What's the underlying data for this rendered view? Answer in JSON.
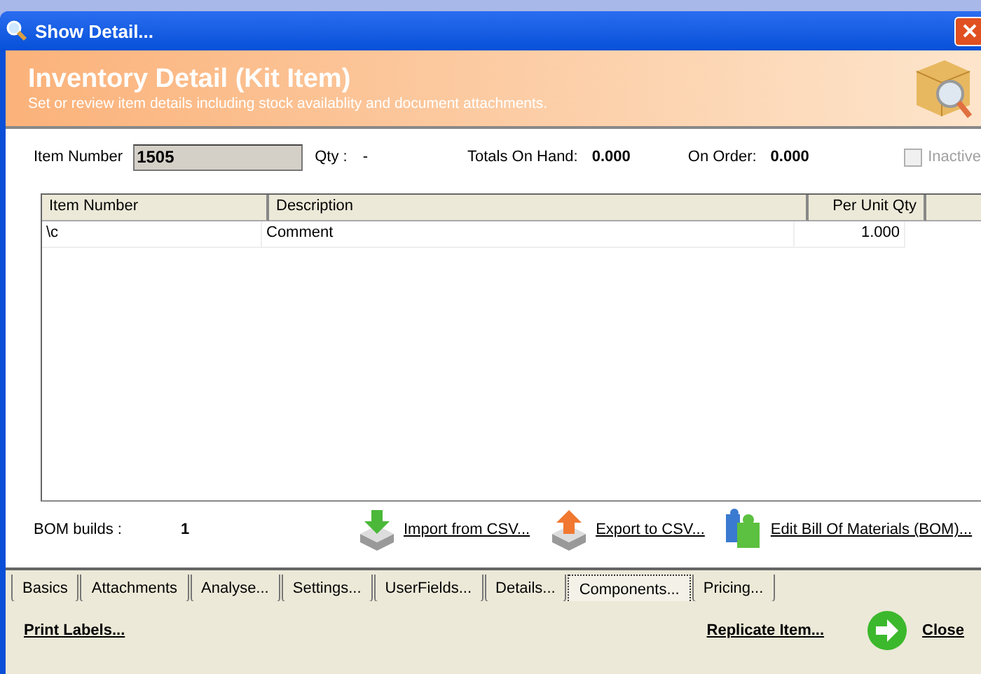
{
  "window": {
    "title": "Show Detail..."
  },
  "header": {
    "title": "Inventory Detail (Kit Item)",
    "subtitle": "Set or review item details including stock availablity and document attachments."
  },
  "summary": {
    "item_number_label": "Item Number",
    "item_number": "1505",
    "qty_label": "Qty :",
    "qty": "-",
    "on_hand_label": "Totals On Hand:",
    "on_hand": "0.000",
    "on_order_label": "On Order:",
    "on_order": "0.000",
    "inactive": {
      "label": "Inactive",
      "checked": false,
      "disabled": true
    }
  },
  "table": {
    "columns": [
      "Item Number",
      "Description",
      "Per Unit Qty"
    ],
    "rows": [
      [
        "\\c",
        "Comment",
        "1.000"
      ]
    ]
  },
  "bom_builds": {
    "label": "BOM builds :",
    "value": "1"
  },
  "actions": [
    {
      "kind": "import",
      "label": "Import from CSV..."
    },
    {
      "kind": "export",
      "label": "Export to CSV..."
    },
    {
      "kind": "bom",
      "label": "Edit Bill Of Materials (BOM)..."
    }
  ],
  "tabs": [
    {
      "label": "Basics",
      "selected": false
    },
    {
      "label": "Attachments",
      "selected": false
    },
    {
      "label": "Analyse...",
      "selected": false
    },
    {
      "label": "Settings...",
      "selected": false
    },
    {
      "label": "UserFields...",
      "selected": false
    },
    {
      "label": "Details...",
      "selected": false
    },
    {
      "label": "Components...",
      "selected": true
    },
    {
      "label": "Pricing...",
      "selected": false
    }
  ],
  "footer": {
    "print_labels": "Print Labels...",
    "replicate": "Replicate Item...",
    "close": "Close"
  }
}
